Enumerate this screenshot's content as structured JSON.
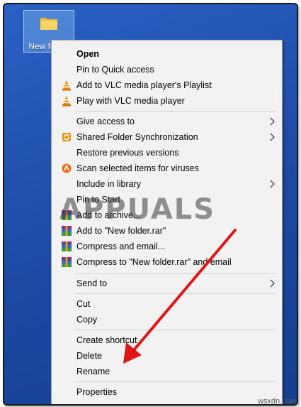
{
  "desktop": {
    "folder_label": "New folder"
  },
  "menu": {
    "items": [
      {
        "label": "Open",
        "icon": "none",
        "submenu": false,
        "bold": true
      },
      {
        "label": "Pin to Quick access",
        "icon": "none",
        "submenu": false
      },
      {
        "label": "Add to VLC media player's Playlist",
        "icon": "vlc-cone-icon",
        "submenu": false
      },
      {
        "label": "Play with VLC media player",
        "icon": "vlc-cone-icon",
        "submenu": false
      },
      {
        "label": "Give access to",
        "icon": "none",
        "submenu": true
      },
      {
        "label": "Shared Folder Synchronization",
        "icon": "sync-icon",
        "submenu": true
      },
      {
        "label": "Restore previous versions",
        "icon": "none",
        "submenu": false
      },
      {
        "label": "Scan selected items for viruses",
        "icon": "avast-icon",
        "submenu": false
      },
      {
        "label": "Include in library",
        "icon": "none",
        "submenu": true
      },
      {
        "label": "Pin to Start",
        "icon": "none",
        "submenu": false
      },
      {
        "label": "Add to archive...",
        "icon": "winrar-icon",
        "submenu": false
      },
      {
        "label": "Add to \"New folder.rar\"",
        "icon": "winrar-icon",
        "submenu": false
      },
      {
        "label": "Compress and email...",
        "icon": "winrar-icon",
        "submenu": false
      },
      {
        "label": "Compress to \"New folder.rar\" and email",
        "icon": "winrar-icon",
        "submenu": false
      },
      {
        "label": "Send to",
        "icon": "none",
        "submenu": true
      },
      {
        "label": "Cut",
        "icon": "none",
        "submenu": false
      },
      {
        "label": "Copy",
        "icon": "none",
        "submenu": false
      },
      {
        "label": "Create shortcut",
        "icon": "none",
        "submenu": false
      },
      {
        "label": "Delete",
        "icon": "none",
        "submenu": false
      },
      {
        "label": "Rename",
        "icon": "none",
        "submenu": false
      },
      {
        "label": "Properties",
        "icon": "none",
        "submenu": false
      }
    ]
  },
  "watermark": "APPUALS",
  "site_tag": "wsxdn.com",
  "colors": {
    "desktop": "#1f4fa8",
    "menu_bg": "#f2f2f2",
    "arrow": "#e01616",
    "vlc_orange": "#f08a00"
  }
}
